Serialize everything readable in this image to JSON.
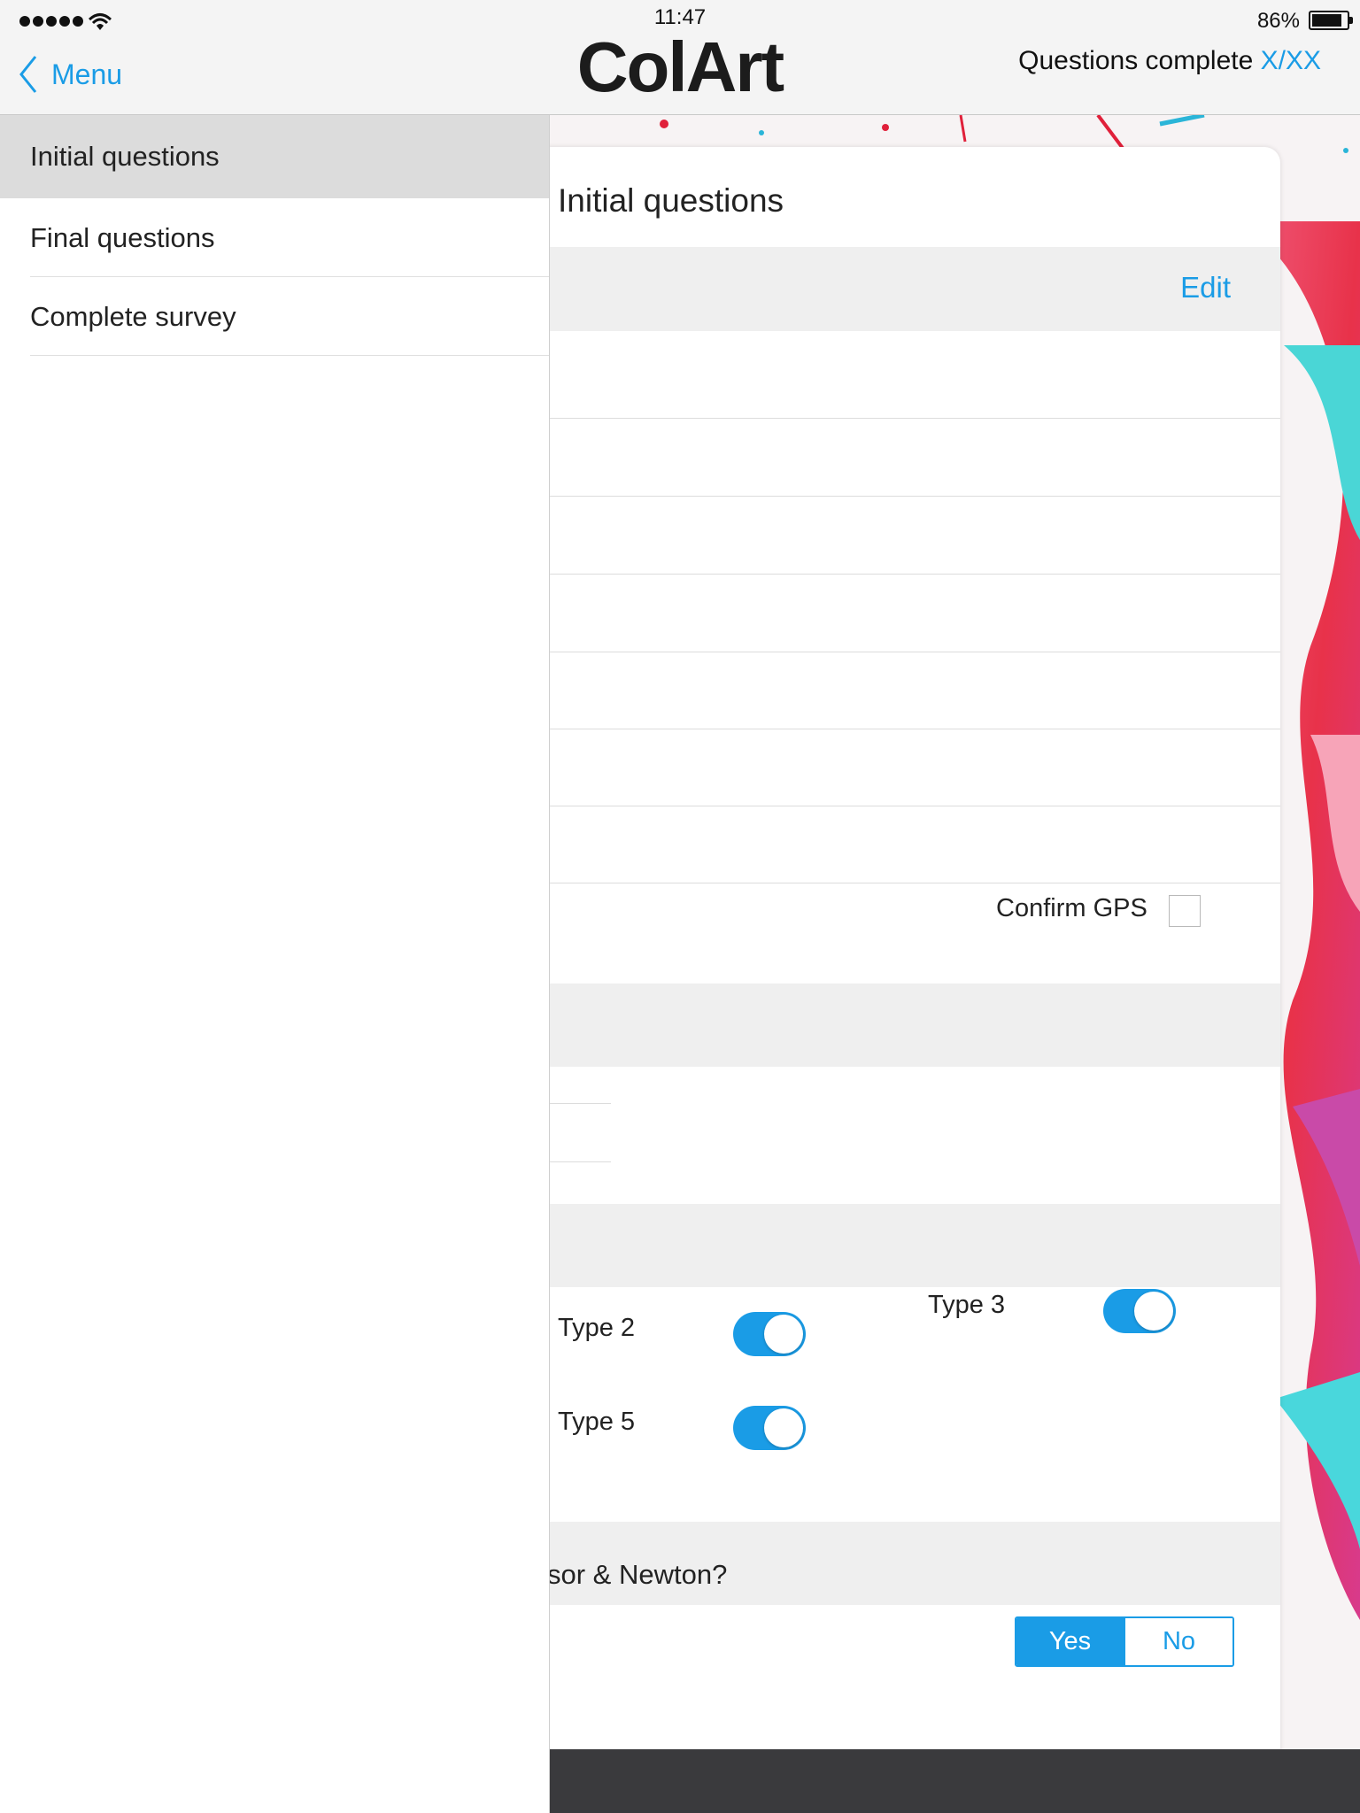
{
  "status": {
    "time": "11:47",
    "battery": "86%"
  },
  "nav": {
    "back_label": "Menu",
    "logo": "ColArt",
    "progress_prefix": "Questions complete",
    "progress_value": "X/XX"
  },
  "sidebar": {
    "items": [
      {
        "label": "Initial questions",
        "active": true
      },
      {
        "label": "Final questions",
        "active": false
      },
      {
        "label": "Complete survey",
        "active": false
      }
    ]
  },
  "content": {
    "title": "Initial questions",
    "edit_label": "Edit",
    "gps_label": "Confirm GPS",
    "gps_checked": false,
    "types": [
      {
        "label": "Type 2",
        "on": true
      },
      {
        "label": "Type 3",
        "on": true
      },
      {
        "label": "Type 5",
        "on": true
      }
    ],
    "question_text": "sor & Newton?",
    "answer": {
      "yes": "Yes",
      "no": "No",
      "selected": "Yes"
    }
  },
  "colors": {
    "accent": "#1a9ce6",
    "band": "#efefef",
    "active_menu": "#dcdcdc",
    "bottom_bar": "#3a3a3d"
  }
}
